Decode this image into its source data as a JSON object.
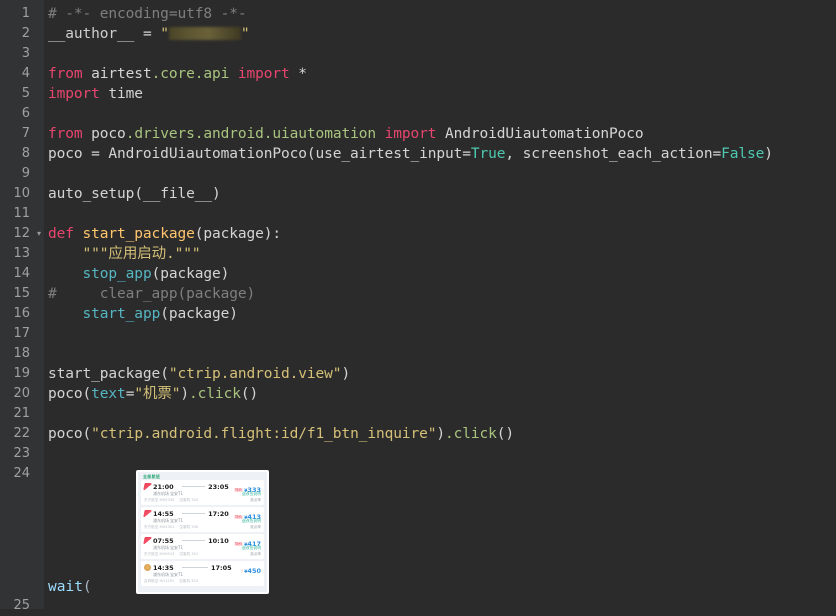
{
  "window": {
    "background_color": "#2b2b2b",
    "gutter_color": "#313335",
    "line_number_color": "#a0a0a0"
  },
  "editor": {
    "language": "python",
    "fold_marker_glyph": "▾",
    "line_numbers": [
      "1",
      "2",
      "3",
      "4",
      "5",
      "6",
      "7",
      "8",
      "9",
      "10",
      "11",
      "12",
      "13",
      "14",
      "15",
      "16",
      "17",
      "18",
      "19",
      "20",
      "21",
      "22",
      "23",
      "24",
      "25"
    ],
    "folded_line": "12",
    "lines": [
      {
        "n": "1",
        "text": "# -*- encoding=utf8 -*-"
      },
      {
        "n": "2",
        "text": "__author__ = \"███████\""
      },
      {
        "n": "3",
        "text": ""
      },
      {
        "n": "4",
        "text": "from airtest.core.api import *"
      },
      {
        "n": "5",
        "text": "import time"
      },
      {
        "n": "6",
        "text": ""
      },
      {
        "n": "7",
        "text": "from poco.drivers.android.uiautomation import AndroidUiautomationPoco"
      },
      {
        "n": "8",
        "text": "poco = AndroidUiautomationPoco(use_airtest_input=True, screenshot_each_action=False)"
      },
      {
        "n": "9",
        "text": ""
      },
      {
        "n": "10",
        "text": "auto_setup(__file__)"
      },
      {
        "n": "11",
        "text": ""
      },
      {
        "n": "12",
        "text": "def start_package(package):"
      },
      {
        "n": "13",
        "text": "    \"\"\"应用启动.\"\"\""
      },
      {
        "n": "14",
        "text": "    stop_app(package)"
      },
      {
        "n": "15",
        "text": "#     clear_app(package)"
      },
      {
        "n": "16",
        "text": "    start_app(package)"
      },
      {
        "n": "17",
        "text": ""
      },
      {
        "n": "18",
        "text": ""
      },
      {
        "n": "19",
        "text": "start_package(\"ctrip.android.view\")"
      },
      {
        "n": "20",
        "text": "poco(text=\"机票\").click()"
      },
      {
        "n": "21",
        "text": ""
      },
      {
        "n": "22",
        "text": "poco(\"ctrip.android.flight:id/f1_btn_inquire\").click()"
      },
      {
        "n": "23",
        "text": ""
      },
      {
        "n": "24",
        "text": "wait(<image>)"
      },
      {
        "n": "25",
        "text": ""
      }
    ],
    "tokens": {
      "comment_line1": "# -*- encoding=utf8 -*-",
      "author_var": "__author__",
      "author_assign": " = ",
      "author_quote_open": "\"",
      "author_quote_close": "\"",
      "kw_from": "from",
      "kw_import": "import",
      "kw_def": "def",
      "mod_airtest": " airtest",
      "mod_airtest_core": ".core",
      "mod_airtest_api": ".api ",
      "star": " *",
      "mod_time": " time",
      "mod_poco": " poco",
      "mod_drivers": ".drivers",
      "mod_android": ".android",
      "mod_uiautomation": ".uiautomation ",
      "cls_poco": " AndroidUiautomationPoco",
      "poco_var": "poco = AndroidUiautomationPoco(use_airtest_input=",
      "true": "True",
      "poco_var2": ", screenshot_each_action=",
      "false": "False",
      "poco_var3": ")",
      "auto_setup": "auto_setup",
      "auto_setup_args": "(__file__)",
      "fn_start_package": " start_package",
      "def_args": "(package):",
      "docstring": "\"\"\"应用启动.\"\"\"",
      "stop_app": "stop_app",
      "stop_app_args": "(package)",
      "comment_clear": "#     clear_app(package)",
      "start_app": "start_app",
      "start_app_args": "(package)",
      "call_start_package": "start_package",
      "str_ctrip_view": "\"ctrip.android.view\"",
      "poco_call": "poco",
      "text_kwarg": "text",
      "eq": "=",
      "str_jipiao": "\"机票\"",
      "dot_click": ".click",
      "empty_parens": "()",
      "str_inquire": "\"ctrip.android.flight:id/f1_btn_inquire\"",
      "wait_fn": "wait",
      "open_paren": "(",
      "close_paren": ")"
    }
  },
  "thumbnail": {
    "name": "flight-list-screenshot",
    "tab_label": "全部航班",
    "flights": [
      {
        "depart_time": "21:00",
        "arrive_time": "23:05",
        "depart_airport": "浦东机场",
        "arrive_airport": "宝安T1",
        "price": "333",
        "currency": "¥",
        "tag": "特价",
        "sub_right": "退改签说明",
        "foot_left": "东方航空 MU5335",
        "foot_mid": "空客机 320",
        "foot_right": "准点率",
        "logo_style": "logo-red"
      },
      {
        "depart_time": "14:55",
        "arrive_time": "17:20",
        "depart_airport": "浦东机场",
        "arrive_airport": "宝安T1",
        "price": "413",
        "currency": "¥",
        "tag": "特价",
        "sub_right": "退改签说明",
        "foot_left": "东方航空 MU5301",
        "foot_mid": "空客机 330",
        "foot_right": "准点率",
        "logo_style": "logo-red"
      },
      {
        "depart_time": "07:55",
        "arrive_time": "10:10",
        "depart_airport": "浦东机场",
        "arrive_airport": "宝安T1",
        "price": "417",
        "currency": "¥",
        "tag": "特价",
        "sub_right": "退改签说明",
        "foot_left": "东方航空 MU9513",
        "foot_mid": "空客机 321",
        "foot_right": "准点率",
        "logo_style": "logo-red"
      },
      {
        "depart_time": "14:35",
        "arrive_time": "17:05",
        "depart_airport": "浦东机场",
        "arrive_airport": "宝安T1",
        "price": "450",
        "currency": "¥",
        "tag": "",
        "sub_right": "",
        "foot_left": "吉祥航空 HO1251",
        "foot_mid": "空客机 320",
        "foot_right": "",
        "logo_style": "logo-tan"
      }
    ]
  },
  "colors": {
    "keyword": "#cc7832",
    "keyword_import": "#e8456e",
    "function_def": "#ffc66d",
    "function_call": "#56b6c2",
    "string": "#d5c078",
    "comment": "#7f7f7f",
    "constant": "#4ec9b0",
    "identifier": "#d4d4d4",
    "price_blue": "#2f8fe0",
    "tag_red": "#e8384f"
  }
}
